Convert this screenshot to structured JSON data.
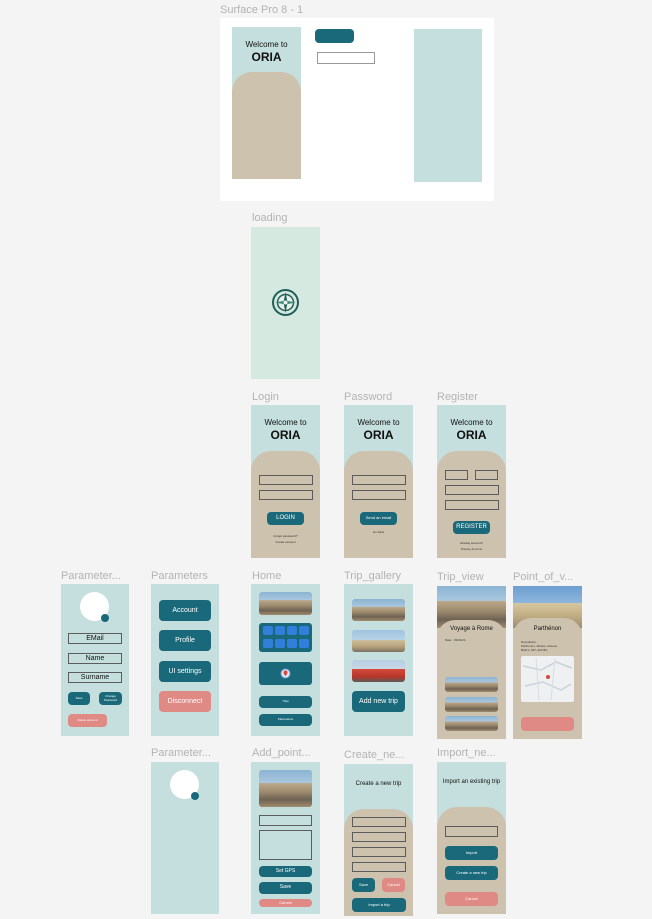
{
  "frames": {
    "surface": {
      "label": "Surface Pro 8 - 1",
      "welcome": "Welcome to",
      "brand": "ORIA"
    },
    "loading": {
      "label": "loading"
    },
    "login": {
      "label": "Login",
      "welcome": "Welcome to",
      "brand": "ORIA",
      "button": "LOGIN",
      "small1": "Forgot password?",
      "small2": "Create account"
    },
    "password": {
      "label": "Password",
      "welcome": "Welcome to",
      "brand": "ORIA",
      "button": "Send an email",
      "small1": "Go back"
    },
    "register": {
      "label": "Register",
      "welcome": "Welcome to",
      "brand": "ORIA",
      "button": "REGISTER",
      "small1": "Already account?",
      "small2": "Privacy & terms"
    },
    "parameters1": {
      "label": "Parameter...",
      "fields": [
        "EMail",
        "Name",
        "Surname"
      ],
      "btn_left": "Save",
      "btn_right": "Change Password",
      "btn_red": "Delete account"
    },
    "parameters2": {
      "label": "Parameters",
      "buttons": [
        "Account",
        "Profile",
        "UI settings"
      ],
      "disconnect": "Disconnect"
    },
    "home": {
      "label": "Home",
      "btn1": "Trips",
      "btn2": "Parameters"
    },
    "trip_gallery": {
      "label": "Trip_gallery",
      "add": "Add new trip"
    },
    "trip_view": {
      "label": "Trip_view",
      "title": "Voyage à Rome",
      "subtitle": "Date : 03/04/24"
    },
    "point_view": {
      "label": "Point_of_v...",
      "title": "Parthénon",
      "desc1": "Description :",
      "desc2": "Parthenon, Athens, Greece",
      "desc3": "Built in 447–432 BC"
    },
    "parameters3": {
      "label": "Parameter..."
    },
    "add_point": {
      "label": "Add_point...",
      "gps": "Set GPS",
      "save": "Save",
      "cancel": "Cancel"
    },
    "create_new": {
      "label": "Create_ne...",
      "title": "Create a new trip",
      "save": "Save",
      "cancel": "Cancel",
      "import": "Import a trip"
    },
    "import_new": {
      "label": "Import_ne...",
      "title": "Import an existing trip",
      "import": "Import",
      "create": "Create a new trip",
      "cancel": "Cancel"
    }
  },
  "colors": {
    "teal_bg": "#c4dfdd",
    "mint_bg": "#d6e9e1",
    "sand": "#cdc2ad",
    "accent": "#19697a",
    "danger": "#e08a86"
  }
}
